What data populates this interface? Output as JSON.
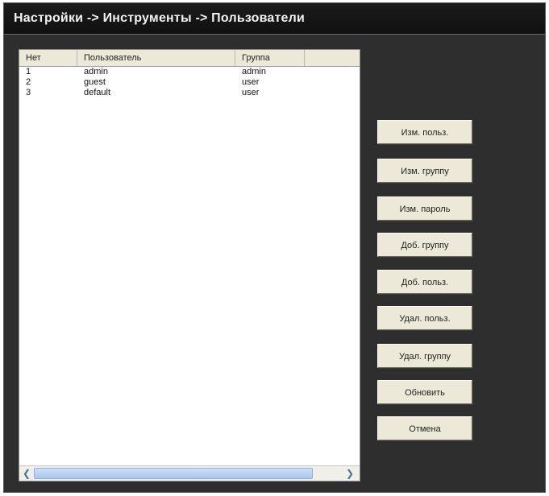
{
  "title": "Настройки -> Инструменты -> Пользователи",
  "table": {
    "headers": [
      "Нет",
      "Пользователь",
      "Группа"
    ],
    "rows": [
      [
        "1",
        "admin",
        "admin"
      ],
      [
        "2",
        "guest",
        "user"
      ],
      [
        "3",
        "default",
        "user"
      ]
    ]
  },
  "buttons": {
    "edit_user": "Изм. польз.",
    "edit_group": "Изм. группу",
    "edit_password": "Изм. пароль",
    "add_group": "Доб. группу",
    "add_user": "Доб. польз.",
    "delete_user": "Удал. польз.",
    "delete_group": "Удал. группу",
    "refresh": "Обновить",
    "cancel": "Отмена"
  },
  "icons": {
    "scroll_left": "chevron-left-icon",
    "scroll_right": "chevron-right-icon"
  }
}
